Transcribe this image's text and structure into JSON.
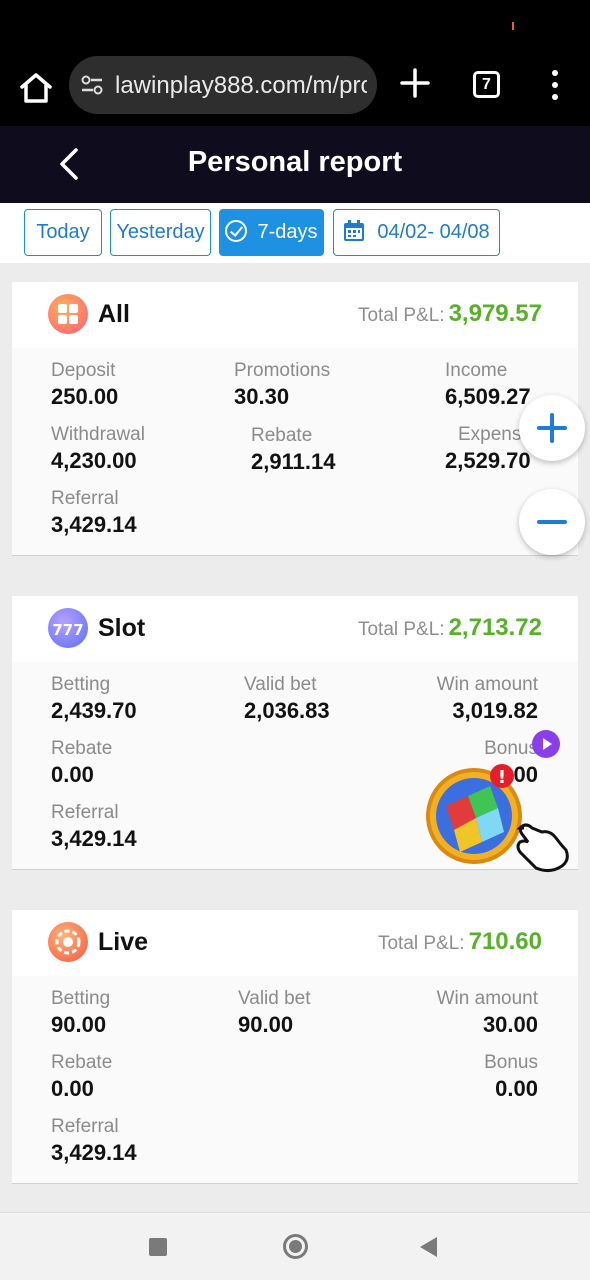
{
  "browser": {
    "url": "lawinplay888.com/m/pro",
    "tab_count": "7"
  },
  "header": {
    "title": "Personal report"
  },
  "filters": {
    "today": "Today",
    "yesterday": "Yesterday",
    "seven_days": "7-days",
    "date_range": "04/02- 04/08",
    "active": "7-days"
  },
  "total_pl_label": "Total P&L:",
  "cards": {
    "all": {
      "name": "All",
      "total_pl": "3,979.57",
      "deposit_label": "Deposit",
      "deposit": "250.00",
      "promotions_label": "Promotions",
      "promotions": "30.30",
      "income_label": "Income",
      "income": "6,509.27",
      "withdrawal_label": "Withdrawal",
      "withdrawal": "4,230.00",
      "rebate_label": "Rebate",
      "rebate": "2,911.14",
      "expense_label": "Expense",
      "expense": "2,529.70",
      "referral_label": "Referral",
      "referral": "3,429.14"
    },
    "slot": {
      "name": "Slot",
      "total_pl": "2,713.72",
      "betting_label": "Betting",
      "betting": "2,439.70",
      "valid_bet_label": "Valid bet",
      "valid_bet": "2,036.83",
      "win_amount_label": "Win amount",
      "win_amount": "3,019.82",
      "rebate_label": "Rebate",
      "rebate": "0.00",
      "bonus_label": "Bonus",
      "bonus": "0.00",
      "referral_label": "Referral",
      "referral": "3,429.14"
    },
    "live": {
      "name": "Live",
      "total_pl": "710.60",
      "betting_label": "Betting",
      "betting": "90.00",
      "valid_bet_label": "Valid bet",
      "valid_bet": "90.00",
      "win_amount_label": "Win amount",
      "win_amount": "30.00",
      "rebate_label": "Rebate",
      "rebate": "0.00",
      "bonus_label": "Bonus",
      "bonus": "0.00",
      "referral_label": "Referral",
      "referral": "3,429.14"
    }
  },
  "colors": {
    "accent": "#1f91e3",
    "profit_green": "#58b02b",
    "header_bg": "#0f0c1e"
  },
  "icons": {
    "home": "home-icon",
    "site_settings": "tune-icon",
    "new_tab": "plus-icon",
    "menu": "more-vert-icon",
    "back": "chevron-left-icon",
    "calendar": "calendar-icon",
    "zoom_in": "zoom-in-icon",
    "zoom_out": "zoom-out-icon"
  }
}
